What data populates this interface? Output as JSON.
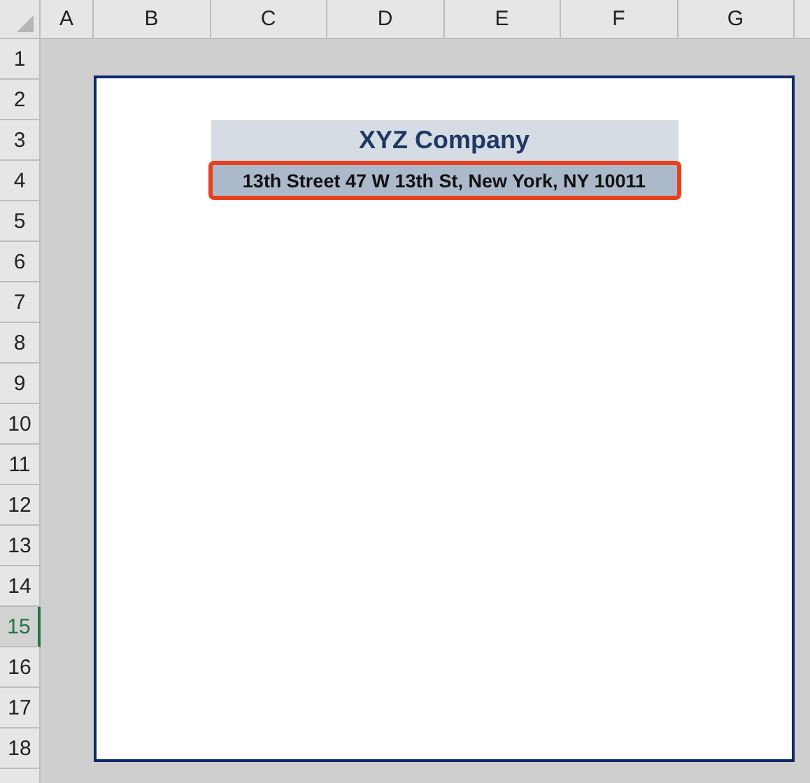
{
  "columns": [
    {
      "label": "A",
      "selected": false
    },
    {
      "label": "B",
      "selected": false
    },
    {
      "label": "C",
      "selected": false
    },
    {
      "label": "D",
      "selected": false
    },
    {
      "label": "E",
      "selected": false
    },
    {
      "label": "F",
      "selected": false
    },
    {
      "label": "G",
      "selected": false
    }
  ],
  "rows": [
    {
      "label": "1",
      "selected": false
    },
    {
      "label": "2",
      "selected": false
    },
    {
      "label": "3",
      "selected": false
    },
    {
      "label": "4",
      "selected": false
    },
    {
      "label": "5",
      "selected": false
    },
    {
      "label": "6",
      "selected": false
    },
    {
      "label": "7",
      "selected": false
    },
    {
      "label": "8",
      "selected": false
    },
    {
      "label": "9",
      "selected": false
    },
    {
      "label": "10",
      "selected": false
    },
    {
      "label": "11",
      "selected": false
    },
    {
      "label": "12",
      "selected": false
    },
    {
      "label": "13",
      "selected": false
    },
    {
      "label": "14",
      "selected": false
    },
    {
      "label": "15",
      "selected": true
    },
    {
      "label": "16",
      "selected": false
    },
    {
      "label": "17",
      "selected": false
    },
    {
      "label": "18",
      "selected": false
    }
  ],
  "page": {
    "title": "XYZ Company",
    "address": {
      "text": "13th Street 47 W 13th St, New York, NY 10011",
      "highlighted": true
    }
  }
}
